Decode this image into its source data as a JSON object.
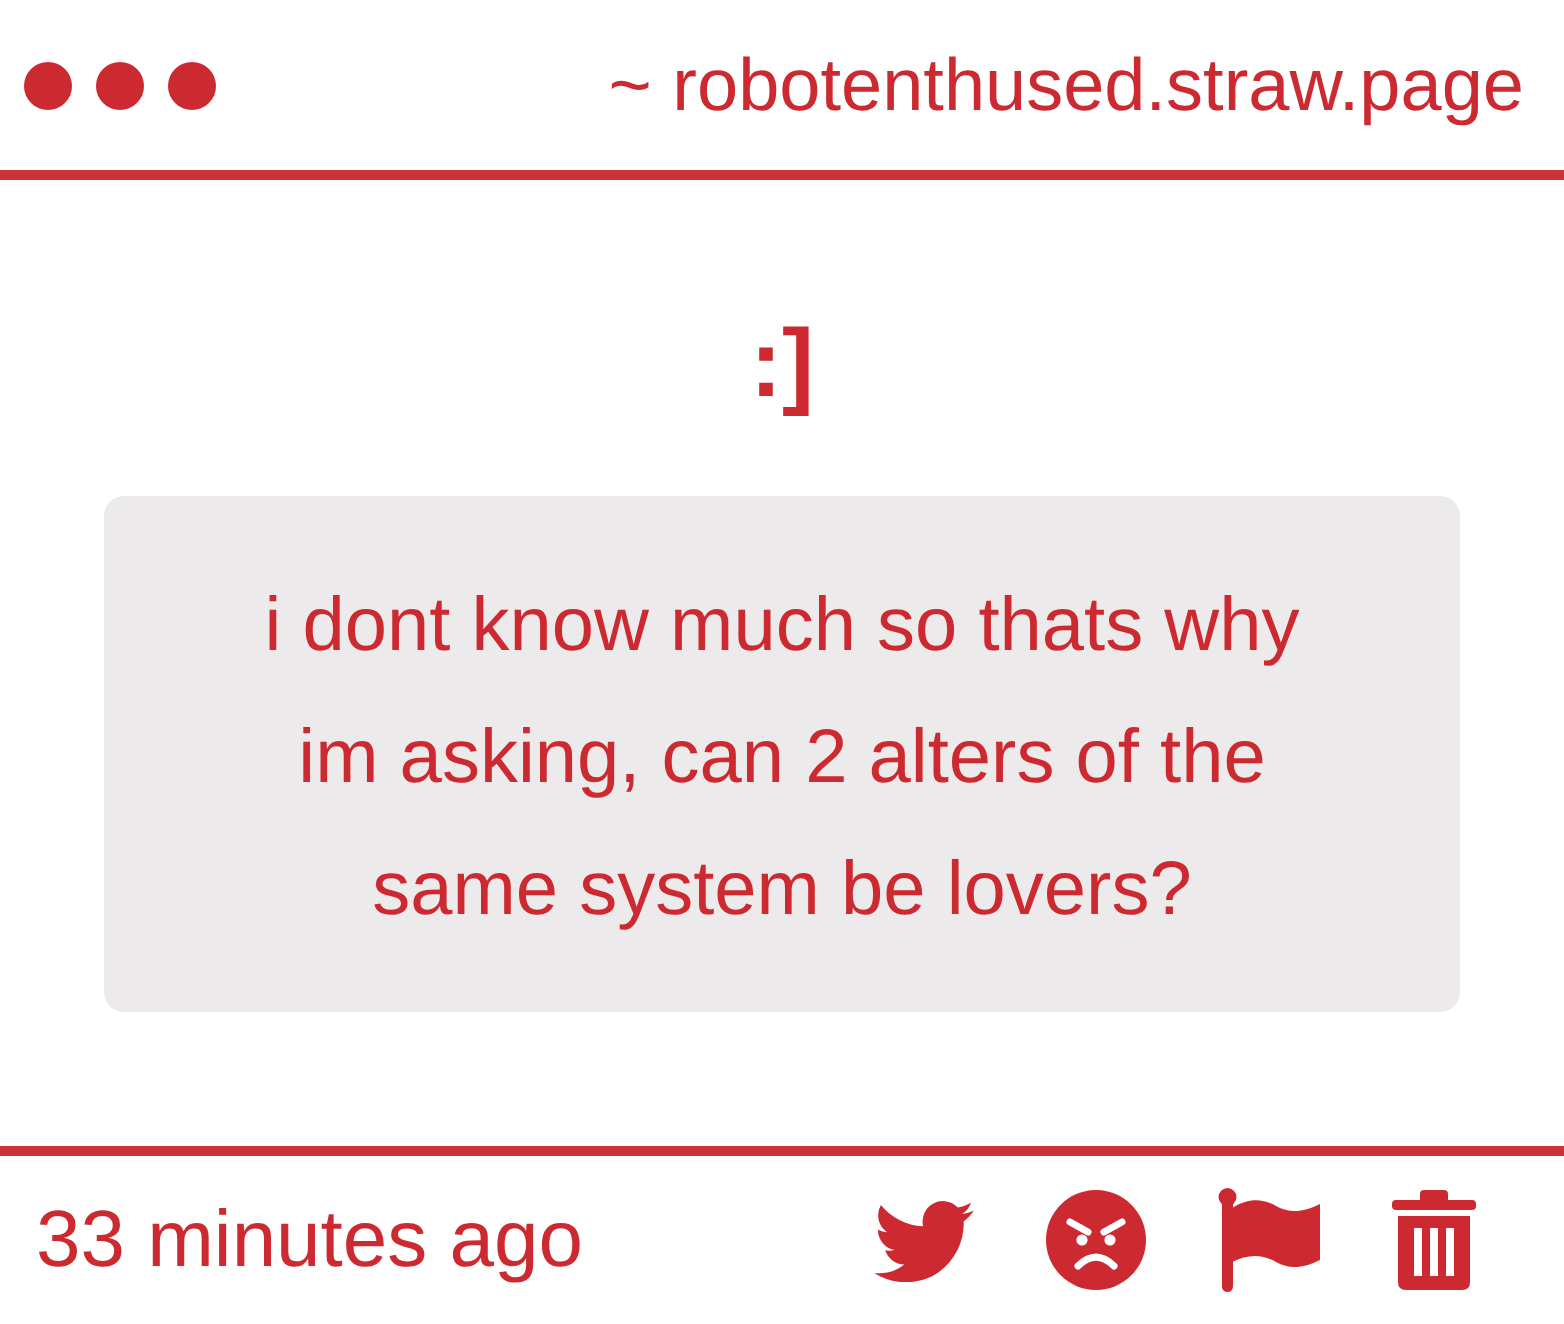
{
  "header": {
    "site": "~ robotenthused.straw.page"
  },
  "post": {
    "emoticon": ":]",
    "question": "i dont know much so thats why im asking, can 2 alters of the same system be lovers?"
  },
  "footer": {
    "time": "33 minutes ago"
  }
}
